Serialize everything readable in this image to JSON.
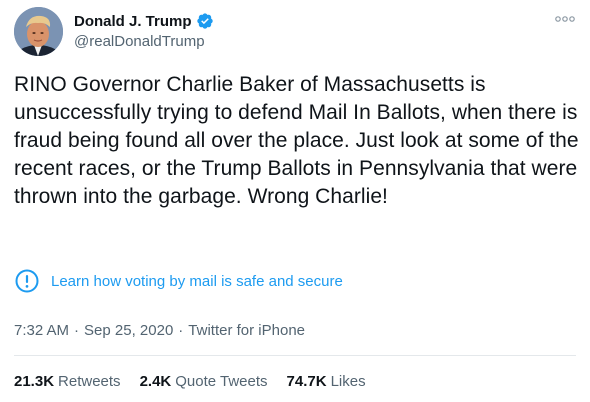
{
  "author": {
    "name": "Donald J. Trump",
    "handle": "@realDonaldTrump",
    "verified": true
  },
  "tweet": {
    "text": "RINO Governor Charlie Baker of Massachusetts is unsuccessfully trying to defend Mail In Ballots, when there is fraud being found all over the place. Just look at some of the recent races, or the Trump Ballots in Pennsylvania that were thrown into the garbage. Wrong Charlie!"
  },
  "notice": {
    "icon": "exclamation-circle-icon",
    "text": "Learn how voting by mail is safe and secure"
  },
  "meta": {
    "time": "7:32 AM",
    "separator": "·",
    "date": "Sep 25, 2020",
    "source": "Twitter for iPhone"
  },
  "stats": {
    "retweets_count": "21.3K",
    "retweets_label": "Retweets",
    "quotes_count": "2.4K",
    "quotes_label": "Quote Tweets",
    "likes_count": "74.7K",
    "likes_label": "Likes"
  },
  "colors": {
    "accent": "#1d9bf0",
    "text": "#0f1419",
    "secondary": "#536471"
  }
}
